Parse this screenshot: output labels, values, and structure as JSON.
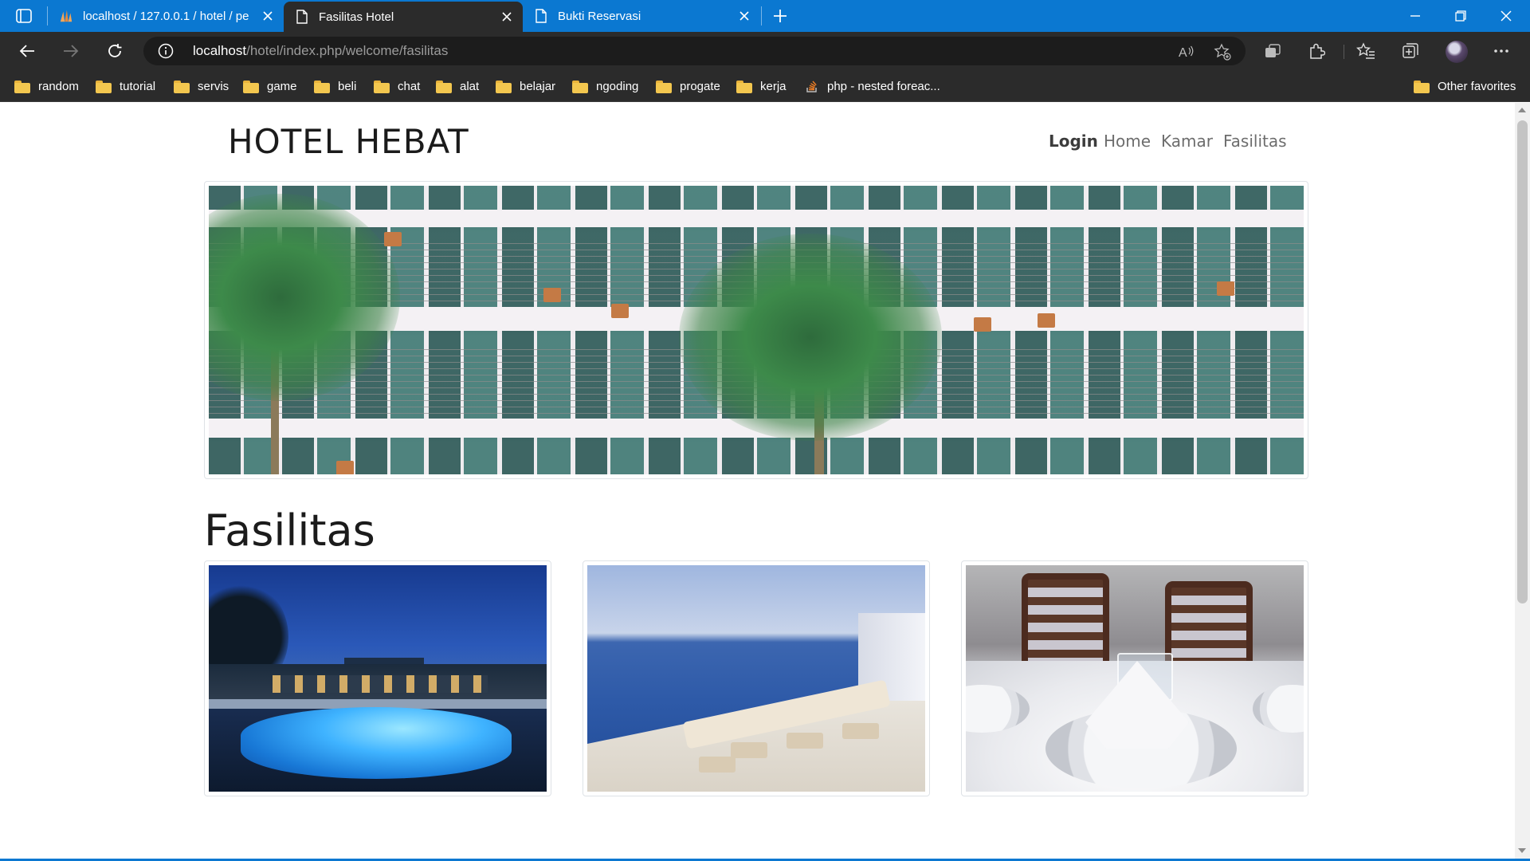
{
  "browser": {
    "tabs": [
      {
        "title": "localhost / 127.0.0.1 / hotel / pe",
        "icon": "phpmyadmin-icon",
        "active": false
      },
      {
        "title": "Fasilitas Hotel",
        "icon": "page-icon",
        "active": true
      },
      {
        "title": "Bukti Reservasi",
        "icon": "page-icon",
        "active": false
      }
    ],
    "url": {
      "host": "localhost",
      "path": "/hotel/index.php/welcome/fasilitas"
    },
    "bookmarks": [
      "random",
      "tutorial",
      "servis",
      "game",
      "beli",
      "chat",
      "alat",
      "belajar",
      "ngoding",
      "progate",
      "kerja"
    ],
    "bookmark_link": "php - nested foreac...",
    "other_favorites": "Other favorites",
    "colors": {
      "titlebar": "#0b78d1",
      "toolbar": "#2b2b2b"
    }
  },
  "page": {
    "brand": "HOTEL HEBAT",
    "nav": [
      {
        "label": "Login",
        "bold": true
      },
      {
        "label": "Home",
        "bold": false
      },
      {
        "label": "Kamar",
        "bold": false
      },
      {
        "label": "Fasilitas",
        "bold": false
      }
    ],
    "section_title": "Fasilitas"
  }
}
